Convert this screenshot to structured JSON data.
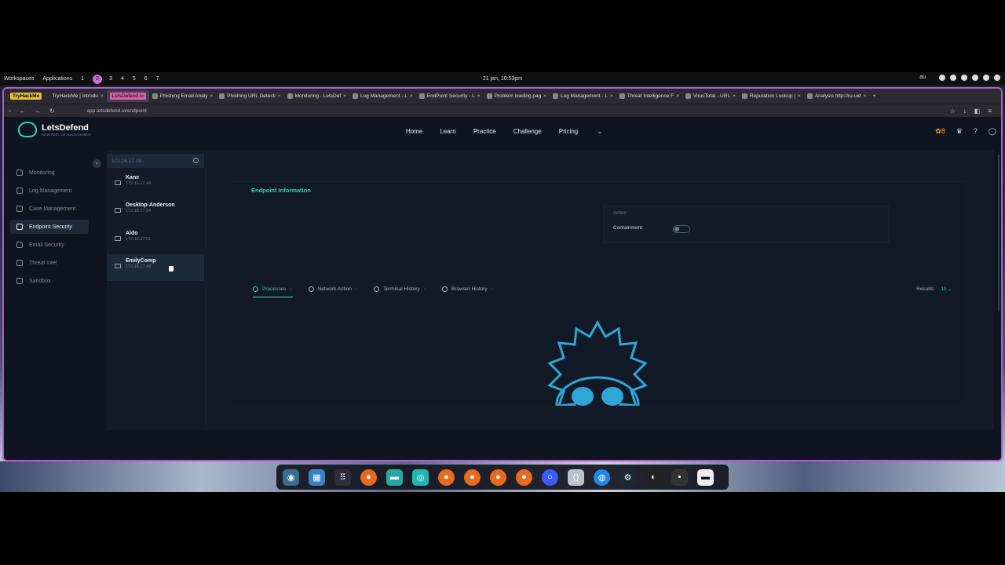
{
  "topbar": {
    "workspaces": "Workspaces",
    "applications": "Applications",
    "ws": [
      "1",
      "2",
      "3",
      "4",
      "5",
      "6",
      "7"
    ],
    "clock": "21 jan, 10:53pm",
    "tray_lang": "au"
  },
  "browser": {
    "tabs": [
      {
        "label": "TryHackMe",
        "badge": true
      },
      {
        "label": "TryHackMe | Introdu"
      },
      {
        "label": "LetsDefend.io",
        "badge2": true
      },
      {
        "label": "Phishing Email Analy"
      },
      {
        "label": "Phishing URL Detecti"
      },
      {
        "label": "Monitoring - LetsDef"
      },
      {
        "label": "Log Management - L"
      },
      {
        "label": "EndPoint Security - L"
      },
      {
        "label": "Problem loading pag"
      },
      {
        "label": "Log Management - L"
      },
      {
        "label": "Threat Intelligence F"
      },
      {
        "label": "VirusTotal - URL"
      },
      {
        "label": "Reputation Lookup |"
      },
      {
        "label": "Analysis http://ru-uid"
      }
    ],
    "url": "app.letsdefend.io/endpoint"
  },
  "site": {
    "logo_text": "LetsDefend",
    "logo_sub": "NOW PART OF HACKTHEBOX",
    "nav": [
      "Home",
      "Learn",
      "Practice",
      "Challenge",
      "Pricing"
    ],
    "streak": "8",
    "sidebar": [
      {
        "label": "Monitoring",
        "icon": "monitor-icon"
      },
      {
        "label": "Log Management",
        "icon": "search-icon"
      },
      {
        "label": "Case Management",
        "icon": "layers-icon"
      },
      {
        "label": "Endpoint Security",
        "icon": "endpoint-icon",
        "active": true
      },
      {
        "label": "Email Security",
        "icon": "mail-icon"
      },
      {
        "label": "Threat Intel",
        "icon": "globe-icon"
      },
      {
        "label": "Sandbox",
        "icon": "cube-icon"
      }
    ]
  },
  "hosts": {
    "search_value": "172.16.17.49",
    "list": [
      {
        "name": "Kane",
        "ip": "172.16.17.44"
      },
      {
        "name": "Desktop-Anderson",
        "ip": "172.16.17.54"
      },
      {
        "name": "Aldo",
        "ip": "172.16.17.51"
      },
      {
        "name": "EmilyComp",
        "ip": "172.16.17.49",
        "selected": true
      }
    ]
  },
  "endpoint": {
    "title": "Endpoint Information",
    "action_label": "Action",
    "containment_label": "Containment:",
    "containment_on": false,
    "tabs": [
      "Processes",
      "Network Action",
      "Terminal History",
      "Browser History"
    ],
    "results_label": "Results:",
    "results_value": "10"
  }
}
